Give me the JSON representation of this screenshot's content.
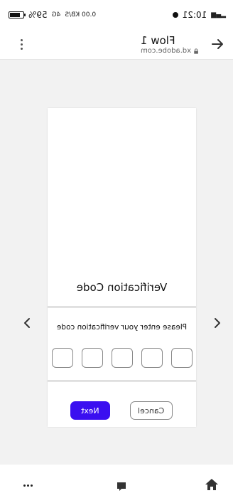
{
  "status_bar": {
    "time": "10:21",
    "battery_percent": "59%",
    "network_small_text": "4G",
    "network_speed_text": "0.00 KB/S"
  },
  "top_bar": {
    "title": "Flow 1",
    "url": "xd.adobe.com"
  },
  "card": {
    "title": "Verification Code",
    "instruction": "Please enter your verification code",
    "code_boxes": [
      "",
      "",
      "",
      "",
      ""
    ],
    "cancel_label": "Cancel",
    "next_label": "Next"
  },
  "colors": {
    "primary_button": "#3a0ff0",
    "viewer_background": "#f2f2f2"
  },
  "icons": {
    "back": "arrow-left-icon",
    "menu": "kebab-menu-icon",
    "prev": "chevron-left-icon",
    "next": "chevron-right-icon",
    "comments": "comment-icon",
    "home": "home-icon",
    "more": "more-dots-icon"
  }
}
